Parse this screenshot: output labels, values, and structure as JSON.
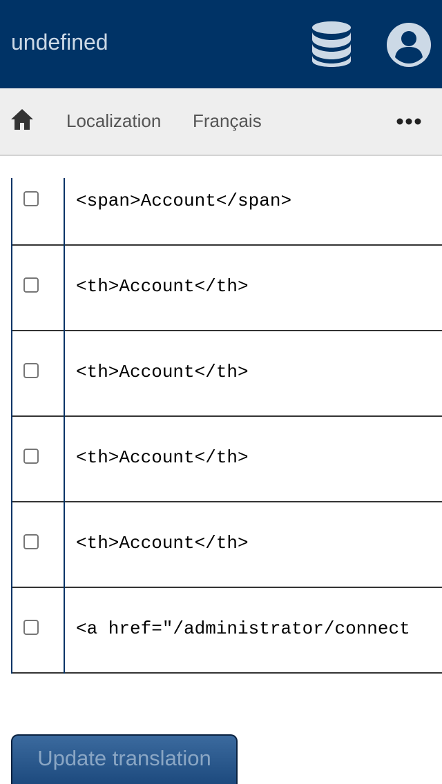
{
  "header": {
    "title": "undefined",
    "icons": {
      "database": "database-icon",
      "user": "user-icon"
    },
    "background": "#003366"
  },
  "breadcrumb": {
    "home_icon": "home-icon",
    "items": [
      "Localization",
      "Français"
    ],
    "more_icon": "more-icon"
  },
  "rows": [
    {
      "text": "<span>Account</span>",
      "checked": false
    },
    {
      "text": "<th>Account</th>",
      "checked": false
    },
    {
      "text": "<th>Account</th>",
      "checked": false
    },
    {
      "text": "<th>Account</th>",
      "checked": false
    },
    {
      "text": "<th>Account</th>",
      "checked": false
    },
    {
      "text": "<a href=\"/administrator/connect",
      "checked": false
    }
  ],
  "actions": {
    "update_label": "Update translation"
  }
}
